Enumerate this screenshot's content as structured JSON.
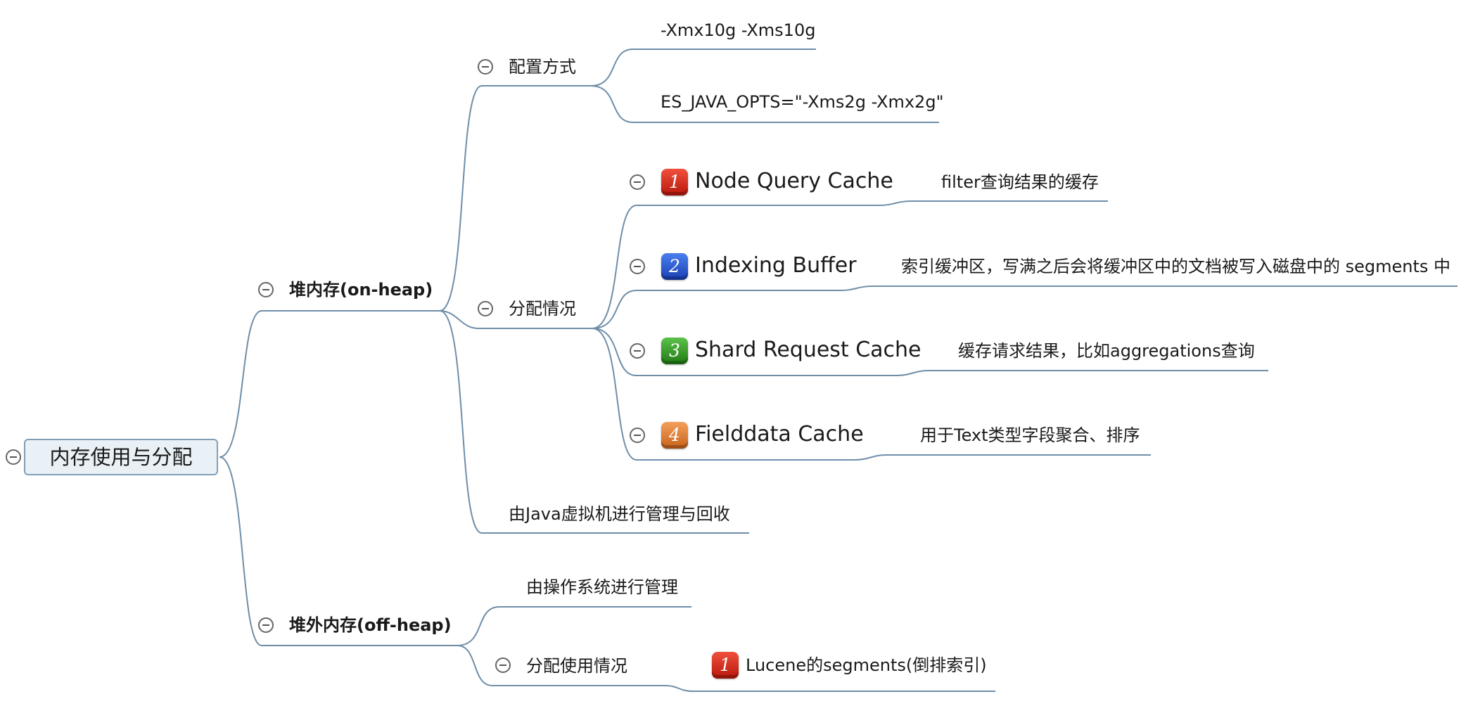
{
  "root": {
    "label": "内存使用与分配"
  },
  "on_heap": {
    "label": "堆内存(on-heap)",
    "config": {
      "label": "配置方式",
      "items": [
        "-Xmx10g -Xms10g",
        "ES_JAVA_OPTS=\"-Xms2g -Xmx2g\""
      ]
    },
    "allocation": {
      "label": "分配情况",
      "items": [
        {
          "badge": "1",
          "color": "#d8281a",
          "label": "Node Query Cache",
          "note": "filter查询结果的缓存"
        },
        {
          "badge": "2",
          "color": "#2a57d6",
          "label": "Indexing Buffer",
          "note": "索引缓冲区，写满之后会将缓冲区中的文档被写入磁盘中的 segments 中"
        },
        {
          "badge": "3",
          "color": "#3a9a2c",
          "label": "Shard Request Cache",
          "note": "缓存请求结果，比如aggregations查询"
        },
        {
          "badge": "4",
          "color": "#e07a30",
          "label": "Fielddata Cache",
          "note": "用于Text类型字段聚合、排序"
        }
      ]
    },
    "managed": "由Java虚拟机进行管理与回收"
  },
  "off_heap": {
    "label": "堆外内存(off-heap)",
    "managed": "由操作系统进行管理",
    "usage": {
      "label": "分配使用情况",
      "items": [
        {
          "badge": "1",
          "color": "#d8281a",
          "label": "Lucene的segments(倒排索引)"
        }
      ]
    }
  },
  "colors": {
    "connector": "#6f8ea8",
    "root_fill": "#eaf1f6",
    "root_border": "#7f9fb8"
  },
  "icons": {
    "toggle": "collapse-minus-icon"
  }
}
